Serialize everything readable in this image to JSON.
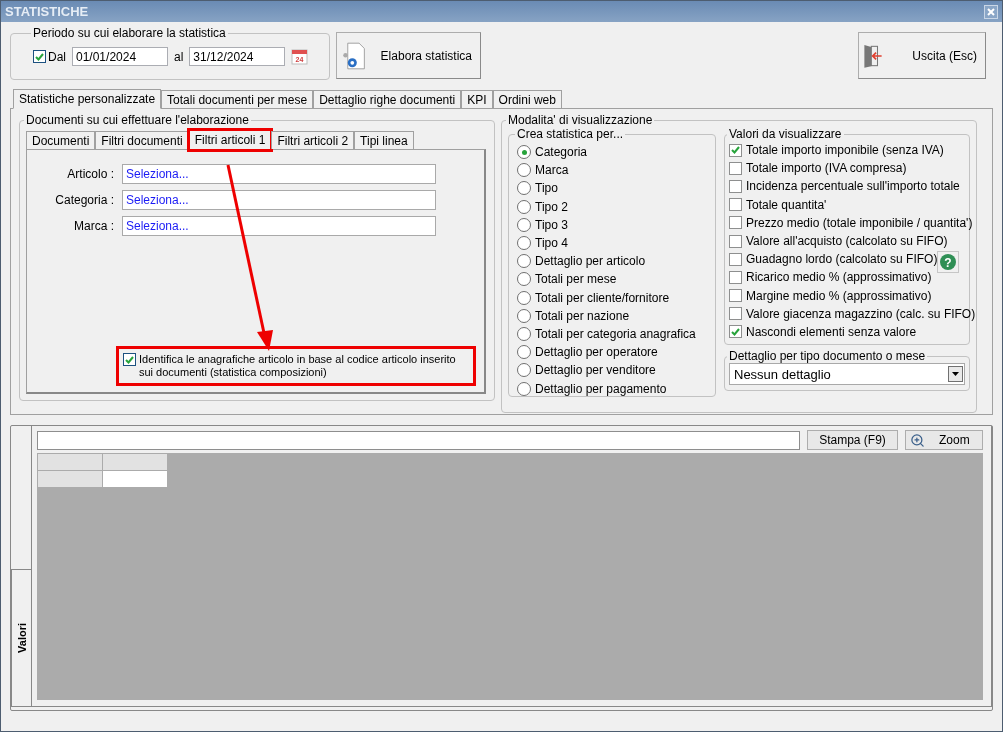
{
  "window": {
    "title": "STATISTICHE"
  },
  "period": {
    "title": "Periodo su cui elaborare la statistica",
    "from_checked": true,
    "from_label": "Dal",
    "from": "01/01/2024",
    "to_label": "al",
    "to": "31/12/2024",
    "calendar_day": "24"
  },
  "buttons": {
    "process": "Elabora statistica",
    "exit": "Uscita (Esc)"
  },
  "tabs": [
    {
      "label": "Statistiche personalizzate",
      "selected": true
    },
    {
      "label": "Totali documenti per mese",
      "selected": false
    },
    {
      "label": "Dettaglio righe documenti",
      "selected": false
    },
    {
      "label": "KPI",
      "selected": false
    },
    {
      "label": "Ordini web",
      "selected": false
    }
  ],
  "documents_group": {
    "title": "Documenti su cui effettuare l'elaborazione",
    "tabs": [
      {
        "label": "Documenti",
        "selected": false,
        "annotated": false
      },
      {
        "label": "Filtri documenti",
        "selected": false,
        "annotated": false
      },
      {
        "label": "Filtri articoli 1",
        "selected": true,
        "annotated": true
      },
      {
        "label": "Filtri articoli 2",
        "selected": false,
        "annotated": false
      },
      {
        "label": "Tipi linea",
        "selected": false,
        "annotated": false
      }
    ],
    "fields": [
      {
        "label": "Articolo :",
        "value": "Seleziona..."
      },
      {
        "label": "Categoria :",
        "value": "Seleziona..."
      },
      {
        "label": "Marca :",
        "value": "Seleziona..."
      }
    ],
    "option": {
      "label": "Identifica le anagrafiche articolo in base al codice articolo inserito sui documenti (statistica composizioni)",
      "checked": true,
      "annotated": true
    }
  },
  "display_group": {
    "title": "Modalita' di visualizzazione",
    "create_by": {
      "title": "Crea statistica per...",
      "options": [
        {
          "label": "Categoria",
          "selected": true
        },
        {
          "label": "Marca",
          "selected": false
        },
        {
          "label": "Tipo",
          "selected": false
        },
        {
          "label": "Tipo 2",
          "selected": false
        },
        {
          "label": "Tipo 3",
          "selected": false
        },
        {
          "label": "Tipo 4",
          "selected": false
        },
        {
          "label": "Dettaglio per articolo",
          "selected": false
        },
        {
          "label": "Totali per mese",
          "selected": false
        },
        {
          "label": "Totali per cliente/fornitore",
          "selected": false
        },
        {
          "label": "Totali per nazione",
          "selected": false
        },
        {
          "label": "Totali per categoria anagrafica",
          "selected": false
        },
        {
          "label": "Dettaglio per operatore",
          "selected": false
        },
        {
          "label": "Dettaglio per venditore",
          "selected": false
        },
        {
          "label": "Dettaglio per pagamento",
          "selected": false
        }
      ]
    },
    "values": {
      "title": "Valori da visualizzare",
      "help": "?",
      "options": [
        {
          "label": "Totale importo imponibile (senza IVA)",
          "checked": true
        },
        {
          "label": "Totale importo (IVA compresa)",
          "checked": false
        },
        {
          "label": "Incidenza percentuale sull'importo totale",
          "checked": false
        },
        {
          "label": "Totale quantita'",
          "checked": false
        },
        {
          "label": "Prezzo medio (totale imponibile / quantita')",
          "checked": false
        },
        {
          "label": "Valore all'acquisto (calcolato su FIFO)",
          "checked": false
        },
        {
          "label": "Guadagno lordo (calcolato su FIFO)",
          "checked": false
        },
        {
          "label": "Ricarico medio % (approssimativo)",
          "checked": false
        },
        {
          "label": "Margine medio % (approssimativo)",
          "checked": false
        },
        {
          "label": "Valore giacenza magazzino (calc. su FIFO)",
          "checked": false
        },
        {
          "label": "Nascondi elementi senza valore",
          "checked": true
        }
      ]
    },
    "detail": {
      "title": "Dettaglio per tipo documento o mese",
      "value": "Nessun dettaglio"
    }
  },
  "results": {
    "side_tab": "Valori",
    "print": "Stampa (F9)",
    "zoom": "Zoom"
  }
}
